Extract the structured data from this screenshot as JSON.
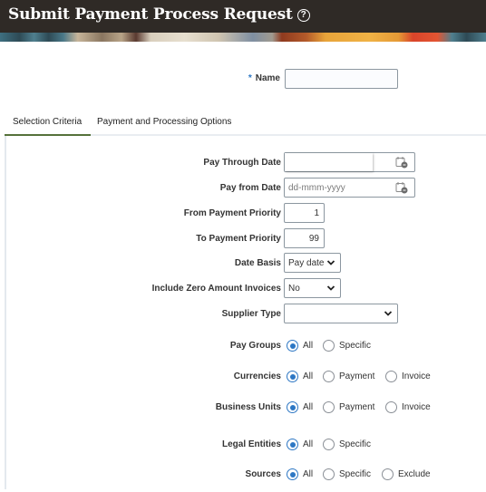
{
  "header": {
    "title": "Submit Payment Process Request",
    "help_icon": "help-circle-icon",
    "help_glyph": "?"
  },
  "name_field": {
    "required_marker": "*",
    "label": "Name",
    "value": ""
  },
  "tabs": [
    {
      "label": "Selection Criteria",
      "active": true
    },
    {
      "label": "Payment and Processing Options",
      "active": false
    }
  ],
  "accent_color": "#55723a",
  "radio_color": "#2d77c4",
  "form": {
    "pay_through_date": {
      "label": "Pay Through Date",
      "value": "",
      "icon": "calendar-icon"
    },
    "pay_from_date": {
      "label": "Pay from Date",
      "placeholder": "dd-mmm-yyyy",
      "value": "",
      "icon": "calendar-icon"
    },
    "from_payment_priority": {
      "label": "From Payment Priority",
      "value": "1"
    },
    "to_payment_priority": {
      "label": "To Payment Priority",
      "value": "99"
    },
    "date_basis": {
      "label": "Date Basis",
      "value": "Pay date"
    },
    "include_zero_amount_invoices": {
      "label": "Include Zero Amount Invoices",
      "value": "No"
    },
    "supplier_type": {
      "label": "Supplier Type",
      "value": ""
    },
    "pay_groups": {
      "label": "Pay Groups",
      "options": [
        "All",
        "Specific"
      ],
      "selected": "All"
    },
    "currencies": {
      "label": "Currencies",
      "options": [
        "All",
        "Payment",
        "Invoice"
      ],
      "selected": "All"
    },
    "business_units": {
      "label": "Business Units",
      "options": [
        "All",
        "Payment",
        "Invoice"
      ],
      "selected": "All"
    },
    "legal_entities": {
      "label": "Legal Entities",
      "options": [
        "All",
        "Specific"
      ],
      "selected": "All"
    },
    "sources": {
      "label": "Sources",
      "options": [
        "All",
        "Specific",
        "Exclude"
      ],
      "selected": "All"
    }
  }
}
